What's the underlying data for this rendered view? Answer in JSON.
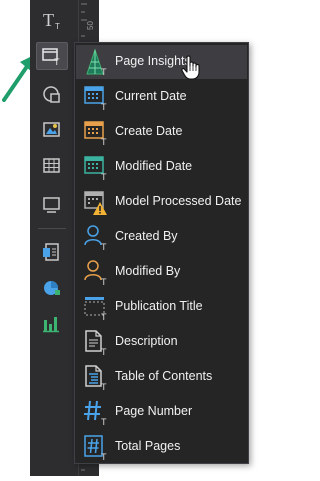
{
  "colors": {
    "toolbar_bg": "#2d2d30",
    "menu_bg": "#252526",
    "menu_hover": "#3e3e42",
    "text": "#f1f1f1",
    "annotation_arrow": "#1f9d6b"
  },
  "ruler": {
    "tick_label": "50"
  },
  "toolbar": {
    "items": [
      {
        "icon": "text-icon",
        "label": "T"
      },
      {
        "icon": "insert-field-icon"
      },
      {
        "icon": "shape-icon"
      },
      {
        "icon": "image-icon"
      },
      {
        "icon": "table-icon"
      },
      {
        "icon": "frame-icon"
      },
      {
        "icon": "report-icon"
      },
      {
        "icon": "pie-chart-icon"
      },
      {
        "icon": "bar-chart-icon"
      }
    ]
  },
  "menu": {
    "items": [
      {
        "label": "Page Insights",
        "icon": "page-insights-icon"
      },
      {
        "label": "Current Date",
        "icon": "calendar-icon"
      },
      {
        "label": "Create Date",
        "icon": "calendar-create-icon"
      },
      {
        "label": "Modified Date",
        "icon": "calendar-modified-icon"
      },
      {
        "label": "Model Processed Date",
        "icon": "calendar-warning-icon"
      },
      {
        "label": "Created By",
        "icon": "user-icon"
      },
      {
        "label": "Modified By",
        "icon": "user-modified-icon"
      },
      {
        "label": "Publication Title",
        "icon": "title-icon"
      },
      {
        "label": "Description",
        "icon": "document-icon"
      },
      {
        "label": "Table of Contents",
        "icon": "table-of-contents-icon"
      },
      {
        "label": "Page Number",
        "icon": "hash-icon"
      },
      {
        "label": "Total Pages",
        "icon": "hash-box-icon"
      }
    ]
  }
}
